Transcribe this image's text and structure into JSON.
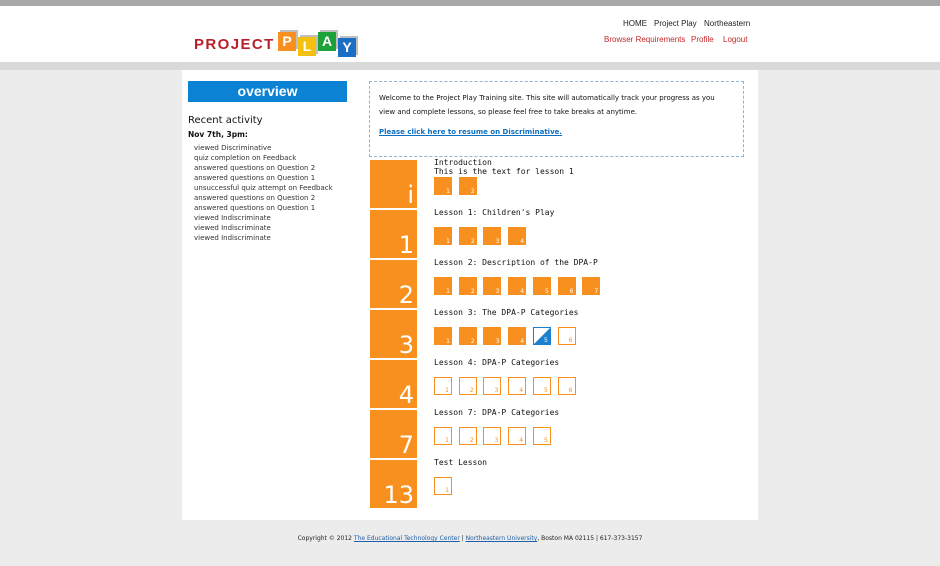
{
  "header": {
    "logo_text": "PROJECT",
    "logo_blocks": [
      {
        "letter": "P",
        "color": "#f7901e"
      },
      {
        "letter": "L",
        "color": "#f4c10f"
      },
      {
        "letter": "A",
        "color": "#1fa13a"
      },
      {
        "letter": "Y",
        "color": "#1a6fc4"
      }
    ],
    "nav_primary": [
      "HOME",
      "Project Play",
      "Northeastern"
    ],
    "nav_secondary": [
      "Browser Requirements",
      "Profile",
      "Logout"
    ]
  },
  "sidebar": {
    "overview_label": "overview",
    "recent_title": "Recent activity",
    "recent_date": "Nov 7th, 3pm:",
    "activities": [
      "viewed Discriminative",
      "quiz completion on Feedback",
      "answered questions on Question 2",
      "answered questions on Question 1",
      "unsuccessful quiz attempt on Feedback",
      "answered questions on Question 2",
      "answered questions on Question 1",
      "viewed Indiscriminate",
      "viewed Indiscriminate",
      "viewed Indiscriminate"
    ]
  },
  "welcome": {
    "line1": "Welcome to the Project Play Training site. This site will automatically track your progress as you",
    "line2": "view and complete lessons, so please feel free to take breaks at anytime.",
    "resume_link": "Please click here to resume on Discriminative."
  },
  "lessons": [
    {
      "num": "i",
      "title": "Introduction",
      "subtitle": "This is the text for lesson 1",
      "pages": [
        {
          "n": "1",
          "s": "done"
        },
        {
          "n": "2",
          "s": "done"
        }
      ]
    },
    {
      "num": "1",
      "title": "Lesson 1: Children's Play",
      "subtitle": "",
      "pages": [
        {
          "n": "1",
          "s": "done"
        },
        {
          "n": "2",
          "s": "done"
        },
        {
          "n": "3",
          "s": "done"
        },
        {
          "n": "4",
          "s": "done"
        }
      ]
    },
    {
      "num": "2",
      "title": "Lesson 2: Description of the DPA-P",
      "subtitle": "",
      "pages": [
        {
          "n": "1",
          "s": "done"
        },
        {
          "n": "2",
          "s": "done"
        },
        {
          "n": "3",
          "s": "done"
        },
        {
          "n": "4",
          "s": "done"
        },
        {
          "n": "5",
          "s": "done"
        },
        {
          "n": "6",
          "s": "done"
        },
        {
          "n": "7",
          "s": "done"
        }
      ]
    },
    {
      "num": "3",
      "title": "Lesson 3: The DPA-P Categories",
      "subtitle": "",
      "pages": [
        {
          "n": "1",
          "s": "done"
        },
        {
          "n": "2",
          "s": "done"
        },
        {
          "n": "3",
          "s": "done"
        },
        {
          "n": "4",
          "s": "done"
        },
        {
          "n": "5",
          "s": "half"
        },
        {
          "n": "6",
          "s": "todo"
        }
      ]
    },
    {
      "num": "4",
      "title": "Lesson 4: DPA-P Categories",
      "subtitle": "",
      "pages": [
        {
          "n": "1",
          "s": "todo"
        },
        {
          "n": "2",
          "s": "todo"
        },
        {
          "n": "3",
          "s": "todo"
        },
        {
          "n": "4",
          "s": "todo"
        },
        {
          "n": "5",
          "s": "todo"
        },
        {
          "n": "6",
          "s": "todo"
        }
      ]
    },
    {
      "num": "7",
      "title": "Lesson 7: DPA-P Categories",
      "subtitle": "",
      "pages": [
        {
          "n": "1",
          "s": "todo"
        },
        {
          "n": "2",
          "s": "todo"
        },
        {
          "n": "3",
          "s": "todo"
        },
        {
          "n": "4",
          "s": "todo"
        },
        {
          "n": "5",
          "s": "todo"
        }
      ]
    },
    {
      "num": "13",
      "title": "Test Lesson",
      "subtitle": "",
      "pages": [
        {
          "n": "1",
          "s": "todo"
        }
      ]
    }
  ],
  "footer": {
    "prefix": "Copyright © 2012 ",
    "link1": "The Educational Technology Center",
    "sep": " | ",
    "link2": "Northeastern University",
    "suffix": ", Boston MA 02115 | 617-373-3157"
  },
  "colors": {
    "orange": "#f7901e",
    "blue": "#0c82d4",
    "red_link": "#c62828"
  }
}
